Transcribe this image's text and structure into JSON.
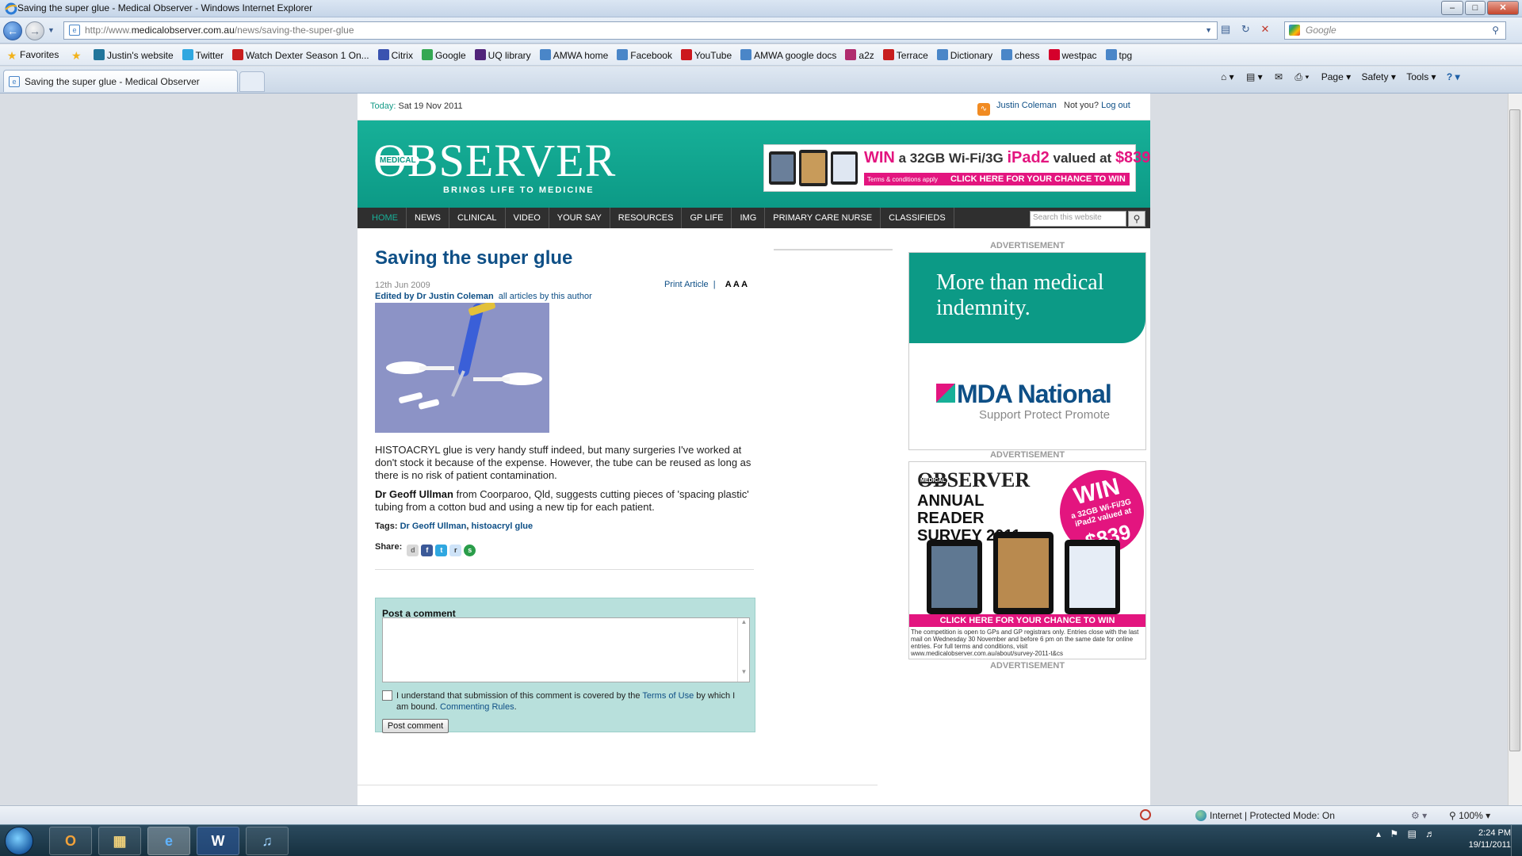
{
  "window": {
    "title": "Saving the super glue - Medical Observer - Windows Internet Explorer",
    "min_label": "–",
    "max_label": "□",
    "close_label": "✕"
  },
  "address": {
    "url_prefix": "http://www.",
    "url_domain": "medicalobserver.com.au",
    "url_path": "/news/saving-the-super-glue",
    "search_placeholder": "Google"
  },
  "favorites": {
    "label": "Favorites",
    "items": [
      {
        "label": "Justin's website",
        "icon": "wordpress-icon",
        "color": "#21759b"
      },
      {
        "label": "Twitter",
        "icon": "twitter-icon",
        "color": "#2fa7e0"
      },
      {
        "label": "Watch Dexter Season 1 On...",
        "icon": "video-icon",
        "color": "#c81e1e"
      },
      {
        "label": "Citrix",
        "icon": "citrix-icon",
        "color": "#3a53b0"
      },
      {
        "label": "Google",
        "icon": "google-icon",
        "color": "#34a853"
      },
      {
        "label": "UQ library",
        "icon": "uq-icon",
        "color": "#51247a"
      },
      {
        "label": "AMWA home",
        "icon": "ie-page-icon",
        "color": "#4a86c8"
      },
      {
        "label": "Facebook",
        "icon": "ie-page-icon",
        "color": "#4a86c8"
      },
      {
        "label": "YouTube",
        "icon": "youtube-icon",
        "color": "#cc181e"
      },
      {
        "label": "AMWA google docs",
        "icon": "ie-page-icon",
        "color": "#4a86c8"
      },
      {
        "label": "a2z",
        "icon": "a2z-icon",
        "color": "#b02c6e"
      },
      {
        "label": "Terrace",
        "icon": "terrace-icon",
        "color": "#c81e1e"
      },
      {
        "label": "Dictionary",
        "icon": "ie-page-icon",
        "color": "#4a86c8"
      },
      {
        "label": "chess",
        "icon": "ie-page-icon",
        "color": "#4a86c8"
      },
      {
        "label": "westpac",
        "icon": "westpac-icon",
        "color": "#d5002b"
      },
      {
        "label": "tpg",
        "icon": "ie-page-icon",
        "color": "#4a86c8"
      }
    ]
  },
  "tab": {
    "title": "Saving the super glue - Medical Observer"
  },
  "commandbar": {
    "page": "Page ▾",
    "safety": "Safety ▾",
    "tools": "Tools ▾",
    "help": "? ▾"
  },
  "site": {
    "today_label": "Today:",
    "today_value": "Sat 19 Nov 2011",
    "user_name": "Justin Coleman",
    "not_you": "Not you?",
    "logout": "Log out",
    "logo_medical": "MEDICAL",
    "logo_big": "OBSERVER",
    "logo_tag": "BRINGS LIFE TO MEDICINE",
    "banner_win": "WIN",
    "banner_mid": " a 32GB Wi-Fi/3G ",
    "banner_ipad": "iPad2",
    "banner_valued": " valued at ",
    "banner_price": "$839",
    "banner_terms": "Terms & conditions apply",
    "banner_cta": "CLICK HERE FOR YOUR CHANCE TO WIN",
    "nav": [
      "HOME",
      "NEWS",
      "CLINICAL",
      "VIDEO",
      "YOUR SAY",
      "RESOURCES",
      "GP LIFE",
      "IMG",
      "PRIMARY CARE NURSE",
      "CLASSIFIEDS"
    ],
    "search_placeholder": "Search this website"
  },
  "article": {
    "title": "Saving the super glue",
    "date": "12th Jun 2009",
    "editor": "Edited by Dr Justin Coleman",
    "all_articles": "all articles by this author",
    "print": "Print Article",
    "font_sizes": "A A A",
    "p1": "HISTOACRYL glue is very handy stuff indeed, but many surgeries I've worked at don't stock it because of the expense. However, the tube can be reused as long as there is no risk of patient contamination.",
    "p2_name": "Dr Geoff Ullman",
    "p2_rest": " from Coorparoo, Qld, suggests cutting pieces of 'spacing plastic' tubing from a cotton bud and using a new tip for each patient.",
    "tags_label": "Tags:",
    "tag1": "Dr Geoff Ullman",
    "tag2": "histoacryl glue",
    "share_label": "Share:"
  },
  "comment": {
    "label": "Post a comment",
    "agree_pre": "I understand that submission of this comment is covered by the ",
    "terms": "Terms of Use",
    "agree_mid": " by which I am bound. ",
    "rules": "Commenting Rules",
    "agree_end": ".",
    "button": "Post comment"
  },
  "ads": {
    "label": "ADVERTISEMENT",
    "mda_text": "More than medical indemnity.",
    "mda_brand": "MDA National",
    "mda_sub": "Support Protect Promote",
    "survey_obs": "OBSERVER",
    "survey_medical": "MEDICAL",
    "survey_title": "ANNUAL READER SURVEY 2011",
    "survey_win": "WIN",
    "survey_desc": "a 32GB Wi-Fi/3G iPad2 valued at",
    "survey_price": "$839",
    "survey_cta": "CLICK HERE FOR YOUR CHANCE TO WIN",
    "survey_fine": "The competition is open to GPs and GP registrars only. Entries close with the last mail on Wednesday 30 November and before 6 pm on the same date for online entries. For full terms and conditions, visit www.medicalobserver.com.au/about/survey-2011-t&cs"
  },
  "status": {
    "zone": "Internet | Protected Mode: On",
    "zoom": "100%"
  },
  "taskbar": {
    "time": "2:24 PM",
    "date": "19/11/2011"
  }
}
